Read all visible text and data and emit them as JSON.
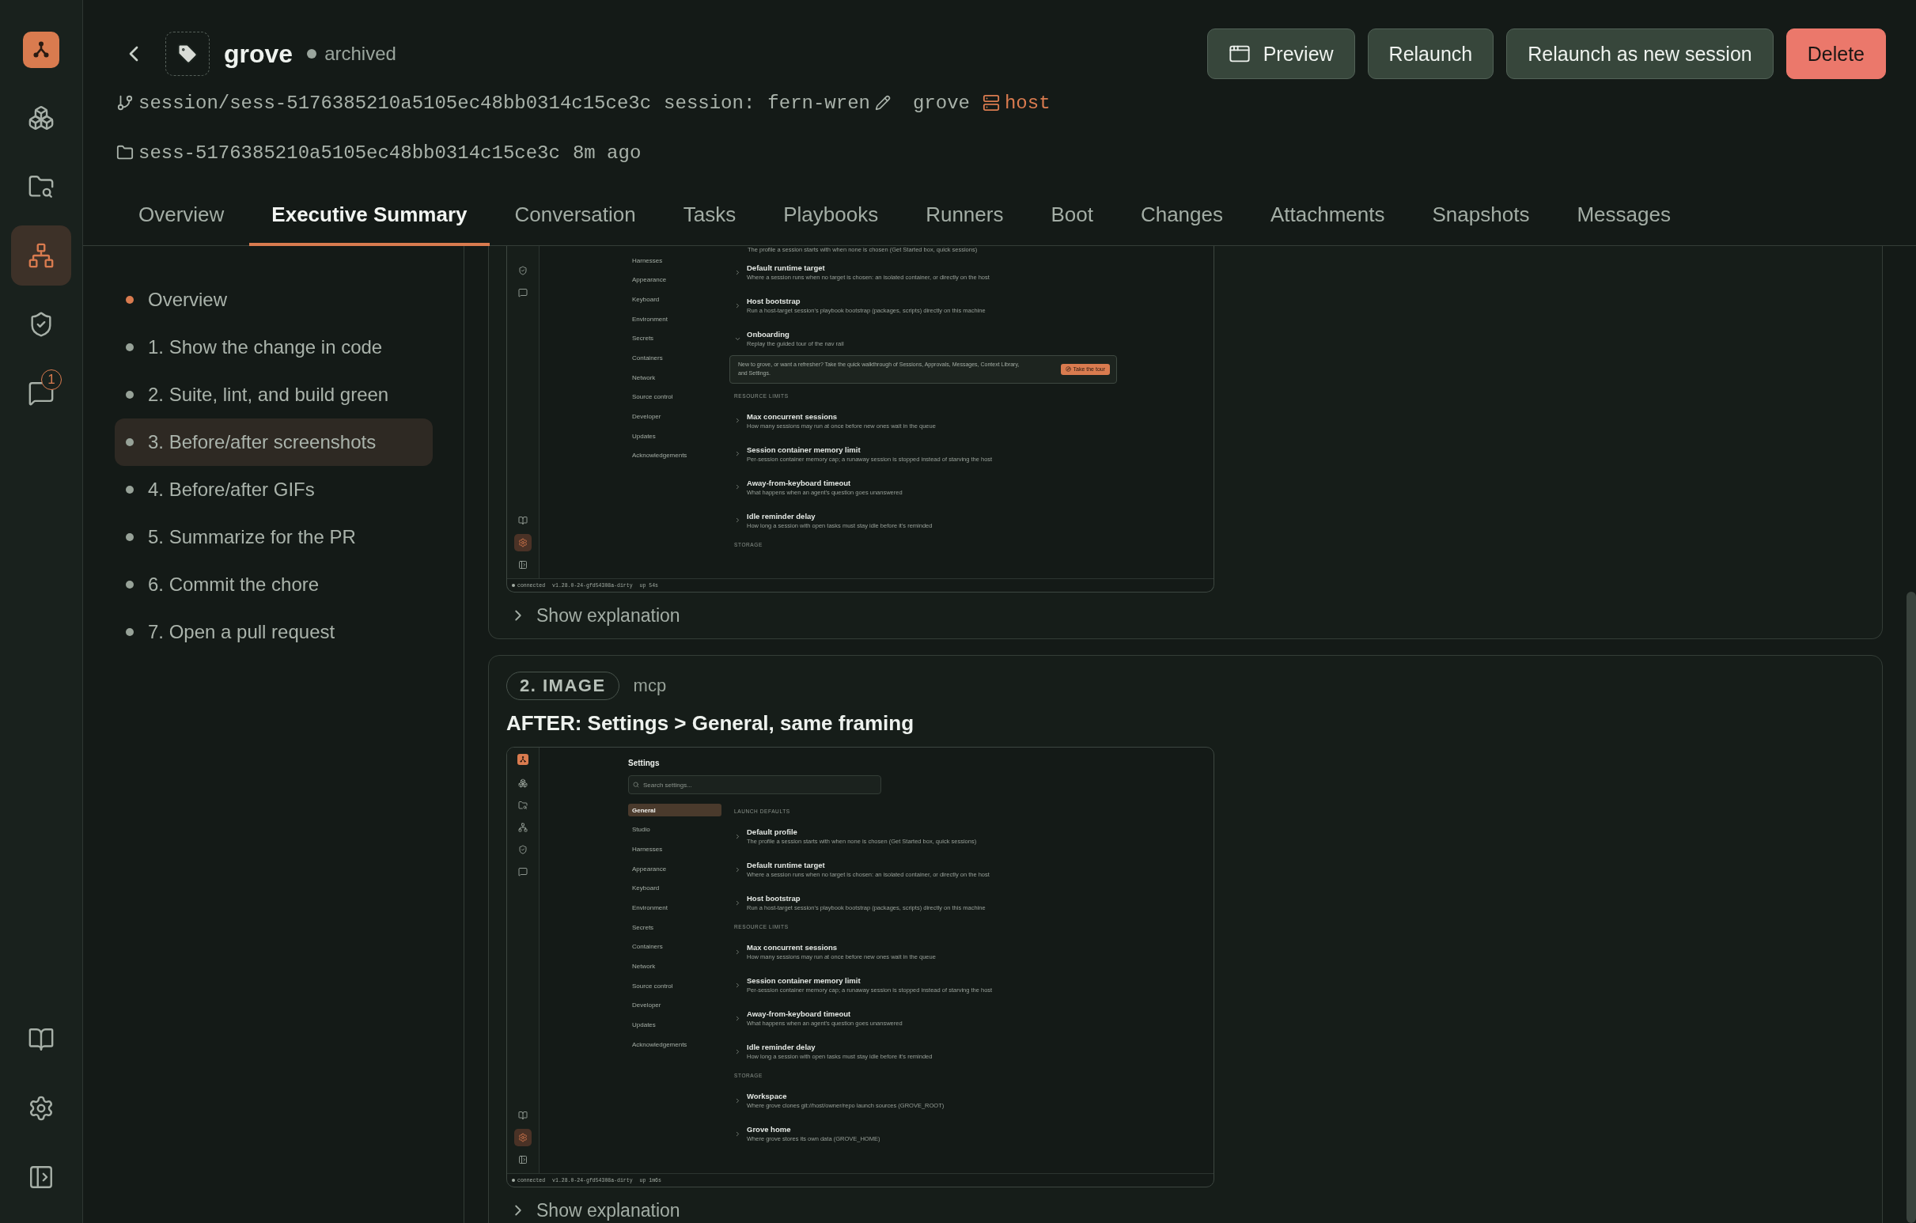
{
  "nav_rail": {
    "top": [
      {
        "kind": "logo",
        "selected": false
      },
      {
        "kind": "cubes",
        "selected": false
      },
      {
        "kind": "folder",
        "selected": false
      },
      {
        "kind": "nodes",
        "selected": true
      },
      {
        "kind": "shield",
        "selected": false
      },
      {
        "kind": "chat",
        "selected": false,
        "badge": "1"
      }
    ],
    "bottom": [
      {
        "kind": "book",
        "selected": false
      },
      {
        "kind": "gear",
        "selected": false
      },
      {
        "kind": "panel",
        "selected": false
      }
    ]
  },
  "header": {
    "title": "grove",
    "status": "archived",
    "branch": "session/sess-5176385210a5105ec48bb0314c15ce3c",
    "session_label": "session:",
    "session_name": "fern-wren",
    "project": "grove",
    "target": "host",
    "folder": "sess-5176385210a5105ec48bb0314c15ce3c",
    "age": "8m ago",
    "buttons": [
      {
        "label": "Preview",
        "kind": "preview"
      },
      {
        "label": "Relaunch",
        "kind": "plain"
      },
      {
        "label": "Relaunch as new session",
        "kind": "plain"
      },
      {
        "label": "Delete",
        "kind": "danger"
      }
    ]
  },
  "tabs": [
    {
      "label": "Overview",
      "selected": false
    },
    {
      "label": "Executive Summary",
      "selected": true
    },
    {
      "label": "Conversation",
      "selected": false
    },
    {
      "label": "Tasks",
      "selected": false
    },
    {
      "label": "Playbooks",
      "selected": false
    },
    {
      "label": "Runners",
      "selected": false
    },
    {
      "label": "Boot",
      "selected": false
    },
    {
      "label": "Changes",
      "selected": false
    },
    {
      "label": "Attachments",
      "selected": false
    },
    {
      "label": "Snapshots",
      "selected": false
    },
    {
      "label": "Messages",
      "selected": false
    }
  ],
  "steps": [
    {
      "label": "Overview",
      "selected": false,
      "current": true
    },
    {
      "label": "1. Show the change in code",
      "selected": false,
      "current": false
    },
    {
      "label": "2. Suite, lint, and build green",
      "selected": false,
      "current": false
    },
    {
      "label": "3. Before/after screenshots",
      "selected": true,
      "current": false
    },
    {
      "label": "4. Before/after GIFs",
      "selected": false,
      "current": false
    },
    {
      "label": "5. Summarize for the PR",
      "selected": false,
      "current": false
    },
    {
      "label": "6. Commit the chore",
      "selected": false,
      "current": false
    },
    {
      "label": "7. Open a pull request",
      "selected": false,
      "current": false
    }
  ],
  "cards": [
    {
      "cut_top": true,
      "screenshot": {
        "rail": {
          "top": [
            {
              "kind": "shield",
              "selected": false
            },
            {
              "kind": "chat",
              "selected": false
            }
          ],
          "bottom": [
            {
              "kind": "book",
              "selected": false
            },
            {
              "kind": "gear",
              "selected": true
            },
            {
              "kind": "panel",
              "selected": false
            }
          ]
        },
        "nav": [
          {
            "label": "Harnesses",
            "selected": false
          },
          {
            "label": "Appearance",
            "selected": false
          },
          {
            "label": "Keyboard",
            "selected": false
          },
          {
            "label": "Environment",
            "selected": false
          },
          {
            "label": "Secrets",
            "selected": false
          },
          {
            "label": "Containers",
            "selected": false
          },
          {
            "label": "Network",
            "selected": false
          },
          {
            "label": "Source control",
            "selected": false
          },
          {
            "label": "Developer",
            "selected": false
          },
          {
            "label": "Updates",
            "selected": false
          },
          {
            "label": "Acknowledgements",
            "selected": false
          }
        ],
        "items": [
          {
            "kind": "note",
            "text": "The profile a session starts with when none is chosen (Get Started box, quick sessions)"
          },
          {
            "kind": "row",
            "title": "Default runtime target",
            "description": "Where a session runs when no target is chosen: an isolated container, or directly on the host",
            "expanded": false
          },
          {
            "kind": "row",
            "title": "Host bootstrap",
            "description": "Run a host-target session's playbook bootstrap (packages, scripts) directly on this machine",
            "expanded": false
          },
          {
            "kind": "row",
            "title": "Onboarding",
            "description": "Replay the guided tour of the nav rail",
            "expanded": true
          },
          {
            "kind": "callout",
            "text": "New to grove, or want a refresher? Take the quick walkthrough of Sessions, Approvals, Messages, Context Library, and Settings.",
            "button": "Take the tour"
          },
          {
            "kind": "label",
            "text": "RESOURCE LIMITS"
          },
          {
            "kind": "row",
            "title": "Max concurrent sessions",
            "description": "How many sessions may run at once before new ones wait in the queue",
            "expanded": false
          },
          {
            "kind": "row",
            "title": "Session container memory limit",
            "description": "Per-session container memory cap; a runaway session is stopped instead of starving the host",
            "expanded": false
          },
          {
            "kind": "row",
            "title": "Away-from-keyboard timeout",
            "description": "What happens when an agent's question goes unanswered",
            "expanded": false
          },
          {
            "kind": "row",
            "title": "Idle reminder delay",
            "description": "How long a session with open tasks must stay idle before it's reminded",
            "expanded": false
          },
          {
            "kind": "label",
            "text": "STORAGE"
          }
        ],
        "status": {
          "connection": "connected",
          "version": "v1.28.0-24-gfd54308a-dirty",
          "uptime": "up 54s"
        }
      },
      "explanation": {
        "label": "Show explanation",
        "expanded": false
      }
    },
    {
      "cut_top": false,
      "badge": "2. IMAGE",
      "source": "mcp",
      "title": "AFTER: Settings > General, same framing",
      "screenshot": {
        "rail": {
          "top": [
            {
              "kind": "logo",
              "selected": false
            },
            {
              "kind": "cubes",
              "selected": false
            },
            {
              "kind": "folder",
              "selected": false
            },
            {
              "kind": "nodes",
              "selected": false
            },
            {
              "kind": "shield",
              "selected": false
            },
            {
              "kind": "chat",
              "selected": false
            }
          ],
          "bottom": [
            {
              "kind": "book",
              "selected": false
            },
            {
              "kind": "gear",
              "selected": true
            },
            {
              "kind": "panel",
              "selected": false
            }
          ]
        },
        "title": "Settings",
        "search_placeholder": "Search settings...",
        "nav": [
          {
            "label": "General",
            "selected": true
          },
          {
            "label": "Studio",
            "selected": false
          },
          {
            "label": "Harnesses",
            "selected": false
          },
          {
            "label": "Appearance",
            "selected": false
          },
          {
            "label": "Keyboard",
            "selected": false
          },
          {
            "label": "Environment",
            "selected": false
          },
          {
            "label": "Secrets",
            "selected": false
          },
          {
            "label": "Containers",
            "selected": false
          },
          {
            "label": "Network",
            "selected": false
          },
          {
            "label": "Source control",
            "selected": false
          },
          {
            "label": "Developer",
            "selected": false
          },
          {
            "label": "Updates",
            "selected": false
          },
          {
            "label": "Acknowledgements",
            "selected": false
          }
        ],
        "items": [
          {
            "kind": "label",
            "text": "LAUNCH DEFAULTS"
          },
          {
            "kind": "row",
            "title": "Default profile",
            "description": "The profile a session starts with when none is chosen (Get Started box, quick sessions)",
            "expanded": false
          },
          {
            "kind": "row",
            "title": "Default runtime target",
            "description": "Where a session runs when no target is chosen: an isolated container, or directly on the host",
            "expanded": false
          },
          {
            "kind": "row",
            "title": "Host bootstrap",
            "description": "Run a host-target session's playbook bootstrap (packages, scripts) directly on this machine",
            "expanded": false
          },
          {
            "kind": "label",
            "text": "RESOURCE LIMITS"
          },
          {
            "kind": "row",
            "title": "Max concurrent sessions",
            "description": "How many sessions may run at once before new ones wait in the queue",
            "expanded": false
          },
          {
            "kind": "row",
            "title": "Session container memory limit",
            "description": "Per-session container memory cap; a runaway session is stopped instead of starving the host",
            "expanded": false
          },
          {
            "kind": "row",
            "title": "Away-from-keyboard timeout",
            "description": "What happens when an agent's question goes unanswered",
            "expanded": false
          },
          {
            "kind": "row",
            "title": "Idle reminder delay",
            "description": "How long a session with open tasks must stay idle before it's reminded",
            "expanded": false
          },
          {
            "kind": "label",
            "text": "STORAGE"
          },
          {
            "kind": "row",
            "title": "Workspace",
            "description": "Where grove clones git://host/owner/repo launch sources (GROVE_ROOT)",
            "expanded": false
          },
          {
            "kind": "row",
            "title": "Grove home",
            "description": "Where grove stores its own data (GROVE_HOME)",
            "expanded": false
          }
        ],
        "status": {
          "connection": "connected",
          "version": "v1.28.0-24-gfd54308a-dirty",
          "uptime": "up 1m6s"
        }
      },
      "explanation": {
        "label": "Show explanation",
        "expanded": false
      }
    }
  ]
}
